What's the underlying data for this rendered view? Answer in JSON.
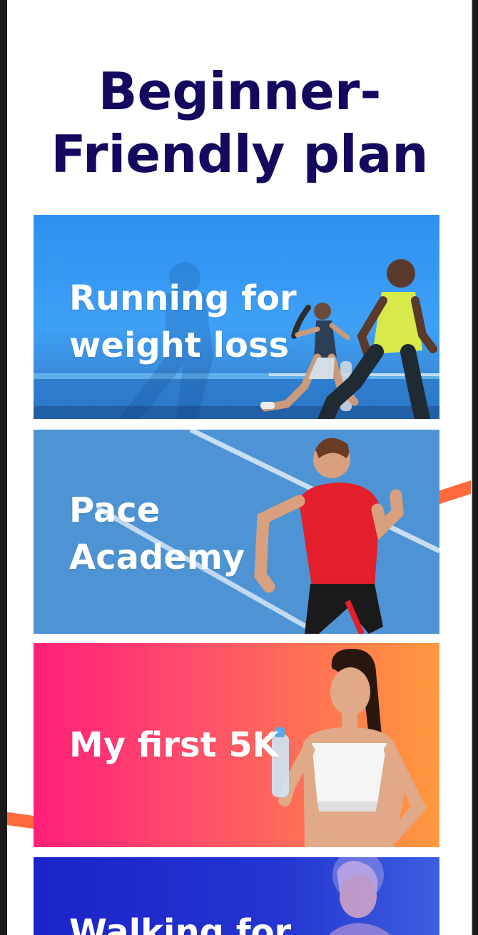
{
  "page": {
    "title": "Beginner-\nFriendly plan"
  },
  "plans": [
    {
      "id": "running",
      "label": "Running for\nweight loss"
    },
    {
      "id": "pace",
      "label": "Pace\nAcademy"
    },
    {
      "id": "5k",
      "label": "My first 5K"
    },
    {
      "id": "walking",
      "label": "Walking for"
    }
  ],
  "colors": {
    "title": "#13095e",
    "running_card": "#3ea0f5",
    "pace_card": "#4e94d4",
    "first5k_card_start": "#ff1f79",
    "first5k_card_end": "#ff9a3d",
    "walking_card": "#1b24c8",
    "accent_stripe": "#ff6a3d"
  },
  "icons": {
    "running": "runners-photo",
    "pace": "sprinter-photo",
    "5k": "woman-with-water-bottle-photo",
    "walking": "woman-with-headphones-photo"
  }
}
